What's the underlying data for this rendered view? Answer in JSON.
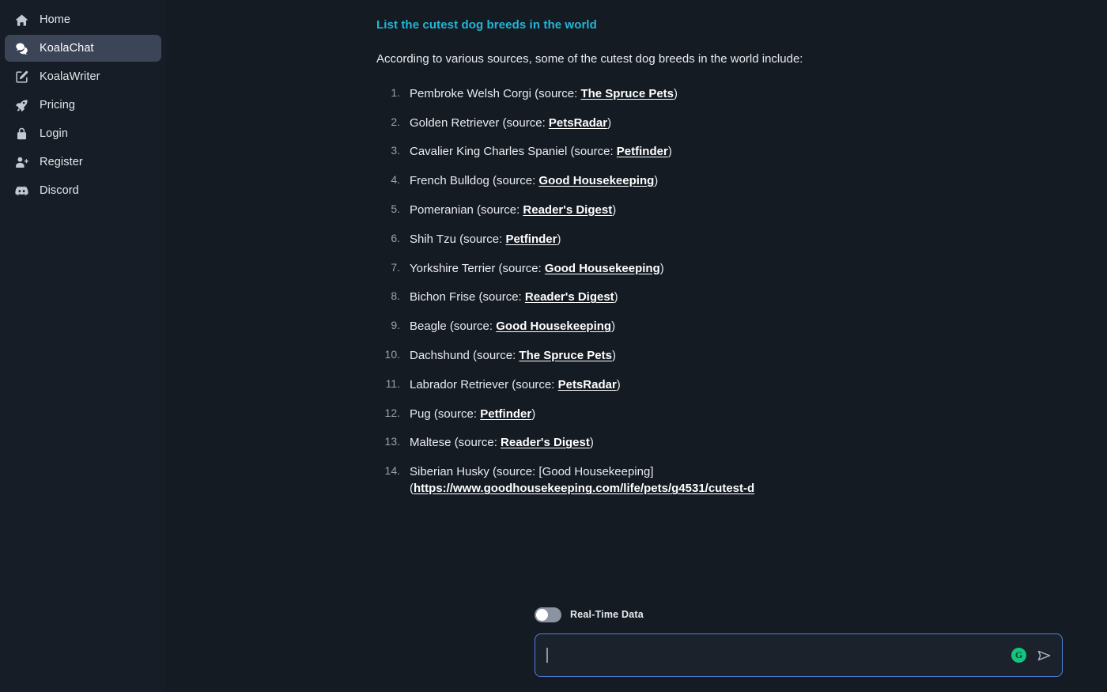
{
  "sidebar": {
    "items": [
      {
        "label": "Home",
        "icon": "home-icon",
        "active": false
      },
      {
        "label": "KoalaChat",
        "icon": "chat-icon",
        "active": true
      },
      {
        "label": "KoalaWriter",
        "icon": "edit-icon",
        "active": false
      },
      {
        "label": "Pricing",
        "icon": "rocket-icon",
        "active": false
      },
      {
        "label": "Login",
        "icon": "lock-icon",
        "active": false
      },
      {
        "label": "Register",
        "icon": "user-plus-icon",
        "active": false
      },
      {
        "label": "Discord",
        "icon": "discord-icon",
        "active": false
      }
    ]
  },
  "conversation": {
    "title": "List the cutest dog breeds in the world",
    "intro": "According to various sources, some of the cutest dog breeds in the world include:",
    "items": [
      {
        "num": "1.",
        "pre": "Pembroke Welsh Corgi (source: ",
        "link": "The Spruce Pets",
        "post": ")"
      },
      {
        "num": "2.",
        "pre": "Golden Retriever (source: ",
        "link": "PetsRadar",
        "post": ")"
      },
      {
        "num": "3.",
        "pre": "Cavalier King Charles Spaniel (source: ",
        "link": "Petfinder",
        "post": ")"
      },
      {
        "num": "4.",
        "pre": "French Bulldog (source: ",
        "link": "Good Housekeeping",
        "post": ")"
      },
      {
        "num": "5.",
        "pre": "Pomeranian (source: ",
        "link": "Reader's Digest",
        "post": ")"
      },
      {
        "num": "6.",
        "pre": "Shih Tzu (source: ",
        "link": "Petfinder",
        "post": ")"
      },
      {
        "num": "7.",
        "pre": "Yorkshire Terrier (source: ",
        "link": "Good Housekeeping",
        "post": ")"
      },
      {
        "num": "8.",
        "pre": "Bichon Frise (source: ",
        "link": "Reader's Digest",
        "post": ")"
      },
      {
        "num": "9.",
        "pre": "Beagle (source: ",
        "link": "Good Housekeeping",
        "post": ")"
      },
      {
        "num": "10.",
        "pre": "Dachshund (source: ",
        "link": "The Spruce Pets",
        "post": ")"
      },
      {
        "num": "11.",
        "pre": "Labrador Retriever (source: ",
        "link": "PetsRadar",
        "post": ")"
      },
      {
        "num": "12.",
        "pre": "Pug (source: ",
        "link": "Petfinder",
        "post": ")"
      },
      {
        "num": "13.",
        "pre": "Maltese (source: ",
        "link": "Reader's Digest",
        "post": ")"
      },
      {
        "num": "14.",
        "pre": "Siberian Husky (source: [Good Housekeeping](",
        "link": "https://www.goodhousekeeping.com/life/pets/g4531/cutest-d",
        "post": ""
      }
    ]
  },
  "composer": {
    "realtime_label": "Real-Time Data",
    "realtime_on": false,
    "input_value": "",
    "input_placeholder": "",
    "grammarly_glyph": "G",
    "send_icon": "send-icon"
  },
  "colors": {
    "background": "#151b23",
    "sidebar": "#171d26",
    "active_item": "#3b4557",
    "title_cyan": "#22b6d6",
    "focus_blue": "#5182e0",
    "grammarly_green": "#15c47e"
  }
}
